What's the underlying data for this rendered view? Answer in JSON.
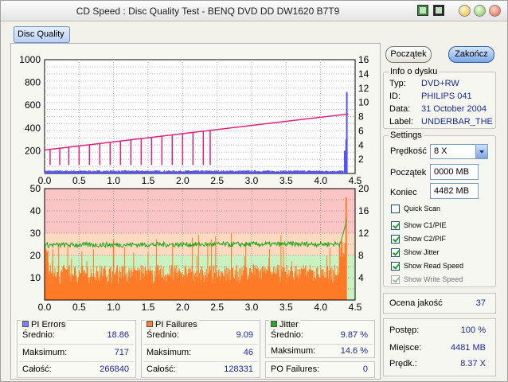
{
  "window": {
    "title": "CD Speed : Disc Quality Test - BENQ    DVD DD DW1620    B7T9"
  },
  "tabs": [
    {
      "label": "Disc Quality",
      "active": true
    }
  ],
  "buttons": {
    "start": "Początek",
    "end": "Zakończ"
  },
  "disc_info": {
    "title": "Info o dysku",
    "rows": [
      {
        "key": "Typ:",
        "value": "DVD+RW"
      },
      {
        "key": "ID:",
        "value": "PHILIPS 041"
      },
      {
        "key": "Data:",
        "value": "31 October 2004"
      },
      {
        "key": "Label:",
        "value": "UNDERBAR_THE"
      }
    ]
  },
  "settings": {
    "title": "Settings",
    "speed_label": "Prędkość",
    "speed_value": "8 X",
    "start_label": "Początek",
    "start_value": "0000 MB",
    "end_label": "Koniec",
    "end_value": "4482 MB",
    "checkboxes": [
      {
        "label": "Quick Scan",
        "checked": false,
        "disabled": false
      },
      {
        "label": "Show C1/PIE",
        "checked": true,
        "disabled": false
      },
      {
        "label": "Show C2/PIF",
        "checked": true,
        "disabled": false
      },
      {
        "label": "Show Jitter",
        "checked": true,
        "disabled": false
      },
      {
        "label": "Show Read Speed",
        "checked": true,
        "disabled": false
      },
      {
        "label": "Show Write Speed",
        "checked": true,
        "disabled": true
      }
    ]
  },
  "quality": {
    "label": "Ocena jakość",
    "value": "37"
  },
  "progress": {
    "rows": [
      {
        "key": "Postęp:",
        "value": "100 %"
      },
      {
        "key": "Miejsce:",
        "value": "4481 MB"
      },
      {
        "key": "Prędk.:",
        "value": "8.37 X"
      }
    ]
  },
  "stats": {
    "pi_errors": {
      "title": "PI Errors",
      "color": "#7b7bff",
      "rows": [
        {
          "key": "Średnio:",
          "value": "18.86"
        },
        {
          "key": "Maksimum:",
          "value": "717"
        },
        {
          "key": "Całość:",
          "value": "266840"
        }
      ]
    },
    "pi_failures": {
      "title": "PI Failures",
      "color": "#ff8033",
      "rows": [
        {
          "key": "Średnio:",
          "value": "9.09"
        },
        {
          "key": "Maksimum:",
          "value": "46"
        },
        {
          "key": "Całość:",
          "value": "128331"
        }
      ]
    },
    "jitter": {
      "title": "Jitter",
      "color": "#22aa22",
      "rows": [
        {
          "key": "Średnio:",
          "value": "9.87 %"
        },
        {
          "key": "Maksimum:",
          "value": "14.6 %"
        }
      ]
    },
    "po_failures": {
      "key": "PO Failures:",
      "value": "0"
    }
  },
  "chart_data": [
    {
      "type": "bar",
      "name": "PI Errors / Read Speed",
      "x_ticks": [
        "0.0",
        "0.5",
        "1.0",
        "1.5",
        "2.0",
        "2.5",
        "3.0",
        "3.5",
        "4.0",
        "4.5"
      ],
      "xlim": [
        0,
        4.5
      ],
      "y_left_ticks": [
        "200",
        "400",
        "600",
        "800",
        "1000"
      ],
      "ylim_left": [
        0,
        1000
      ],
      "y_right_ticks": [
        "2",
        "4",
        "6",
        "8",
        "10",
        "12",
        "14",
        "16"
      ],
      "ylim_right": [
        0,
        16
      ],
      "pi_errors_baseline": 22,
      "pi_errors_spikes": [
        {
          "x": 4.35,
          "y": 200
        },
        {
          "x": 4.37,
          "y": 300
        },
        {
          "x": 4.38,
          "y": 717
        }
      ],
      "read_speed_line": [
        {
          "x": 0.0,
          "y": 3.3
        },
        {
          "x": 4.4,
          "y": 8.37
        }
      ],
      "read_speed_dips": [
        0.08,
        0.22,
        0.35,
        0.5,
        0.65,
        0.8,
        0.95,
        1.1,
        1.25,
        1.4,
        1.55,
        1.7,
        1.85,
        2.0,
        2.15,
        2.3,
        2.4
      ],
      "grid": true
    },
    {
      "type": "area",
      "name": "PI Failures / Jitter",
      "x_ticks": [
        "0.0",
        "0.5",
        "1.0",
        "1.5",
        "2.0",
        "2.5",
        "3.0",
        "3.5",
        "4.0",
        "4.5"
      ],
      "xlim": [
        0,
        4.5
      ],
      "y_left_ticks": [
        "10",
        "20",
        "30",
        "40",
        "50"
      ],
      "ylim_left": [
        0,
        50
      ],
      "y_right_ticks": [
        "4",
        "8",
        "12",
        "16",
        "20"
      ],
      "ylim_right": [
        0,
        20
      ],
      "pi_failures_level": 10,
      "pi_failures_max": 46,
      "jitter_level": 9.87,
      "jitter_max": 14.6,
      "grid": true
    }
  ]
}
